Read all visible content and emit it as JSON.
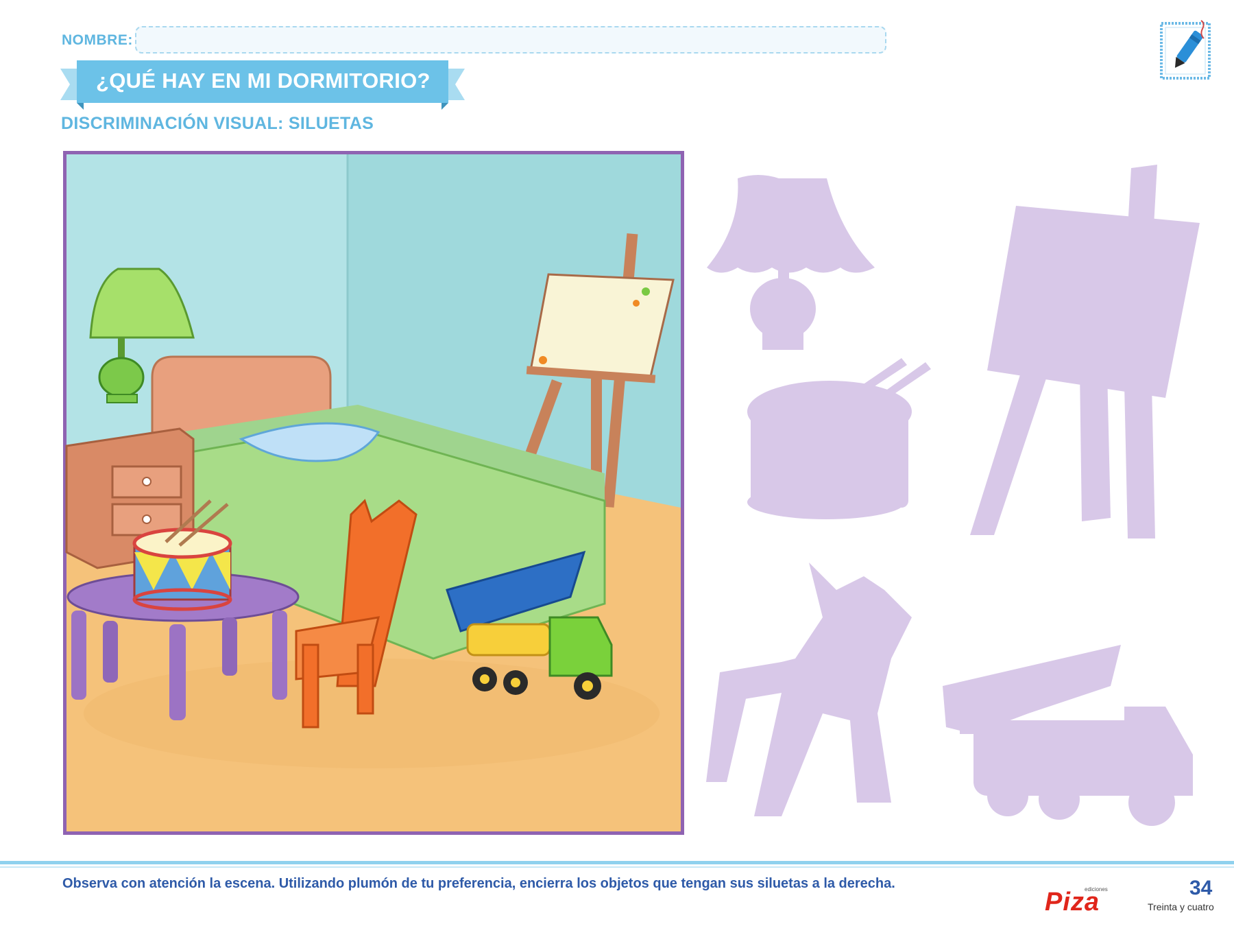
{
  "header": {
    "name_label": "NOMBRE:",
    "title": "¿QUÉ HAY EN MI DORMITORIO?",
    "subtitle": "DISCRIMINACIÓN VISUAL: SILUETAS"
  },
  "scene": {
    "objects": [
      "lamp",
      "bed",
      "easel",
      "nightstand",
      "drum",
      "table",
      "chair",
      "dump-truck"
    ]
  },
  "silhouettes": {
    "items": [
      "lamp",
      "drum",
      "easel",
      "chair",
      "dump-truck"
    ],
    "color": "#d8c8e8"
  },
  "footer": {
    "instructions": "Observa con atención la escena. Utilizando plumón de tu preferencia, encierra los objetos que tengan sus siluetas a la derecha.",
    "brand_small": "ediciones",
    "brand": "Piza",
    "page_number": "34",
    "page_words": "Treinta y cuatro"
  },
  "colors": {
    "accent": "#5fb6e0",
    "frame": "#8f63b2",
    "footer_text": "#2e5aa8",
    "brand": "#e0261b"
  }
}
